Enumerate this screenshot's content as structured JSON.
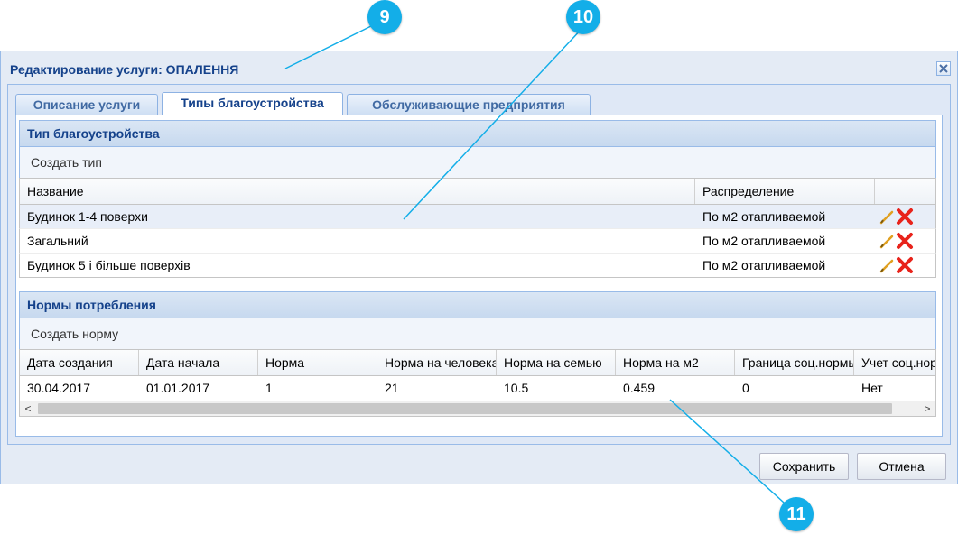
{
  "window": {
    "title": "Редактирование услуги: ОПАЛЕННЯ",
    "close_icon": "close-icon"
  },
  "tabs": [
    {
      "label": "Описание услуги",
      "active": false
    },
    {
      "label": "Типы благоустройства",
      "active": true
    },
    {
      "label": "Обслуживающие предприятия",
      "active": false
    }
  ],
  "types_panel": {
    "title": "Тип благоустройства",
    "create_label": "Создать тип",
    "columns": [
      "Название",
      "Распределение",
      ""
    ],
    "rows": [
      {
        "name": "Будинок 1-4 поверхи",
        "distribution": "По м2 отапливаемой"
      },
      {
        "name": "Загальний",
        "distribution": "По м2 отапливаемой"
      },
      {
        "name": "Будинок 5 і більше поверхів",
        "distribution": "По м2 отапливаемой"
      }
    ],
    "row_actions": [
      "edit-pencil-icon",
      "delete-x-icon"
    ]
  },
  "norms_panel": {
    "title": "Нормы потребления",
    "create_label": "Создать норму",
    "columns": [
      "Дата создания",
      "Дата начала",
      "Норма",
      "Норма на человека",
      "Норма на семью",
      "Норма на м2",
      "Граница соц.нормы",
      "Учет соц.нормы"
    ],
    "rows": [
      [
        "30.04.2017",
        "01.01.2017",
        "1",
        "21",
        "10.5",
        "0.459",
        "0",
        "Нет"
      ]
    ],
    "scroll_left": "<",
    "scroll_right": ">"
  },
  "footer": {
    "save_label": "Сохранить",
    "cancel_label": "Отмена"
  },
  "callouts": [
    "9",
    "10",
    "11"
  ],
  "colors": {
    "callout": "#13aee8",
    "title": "#15428b",
    "border": "#99bbe8",
    "delete": "#e8231b",
    "edit": "#e0a020"
  }
}
